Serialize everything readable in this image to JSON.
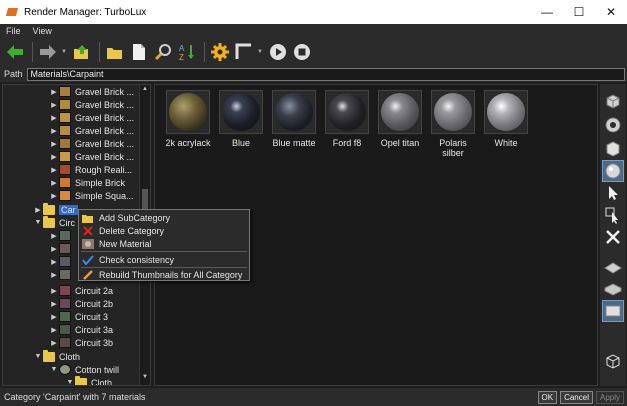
{
  "window": {
    "title": "Render Manager: TurboLux"
  },
  "menu": {
    "file": "File",
    "view": "View"
  },
  "path": {
    "label": "Path",
    "value": "Materials\\Carpaint"
  },
  "tree": {
    "items": [
      {
        "label": "Gravel Brick ..."
      },
      {
        "label": "Gravel Brick ..."
      },
      {
        "label": "Gravel Brick ..."
      },
      {
        "label": "Gravel Brick ..."
      },
      {
        "label": "Gravel Brick ..."
      },
      {
        "label": "Gravel Brick ..."
      },
      {
        "label": "Rough Reali..."
      },
      {
        "label": "Simple Brick"
      },
      {
        "label": "Simple Squa..."
      },
      {
        "label": "Car"
      },
      {
        "label": "Circ"
      },
      {
        "label": "Circuit 2a"
      },
      {
        "label": "Circuit 2b"
      },
      {
        "label": "Circuit 3"
      },
      {
        "label": "Circuit 3a"
      },
      {
        "label": "Circuit 3b"
      },
      {
        "label": "Cloth"
      },
      {
        "label": "Cotton twill"
      },
      {
        "label": "Cloth"
      }
    ]
  },
  "materials": [
    {
      "name": "2k acrylack"
    },
    {
      "name": "Blue"
    },
    {
      "name": "Blue matte"
    },
    {
      "name": "Ford f8"
    },
    {
      "name": "Opel titan"
    },
    {
      "name": "Polaris silber"
    },
    {
      "name": "White"
    }
  ],
  "context_menu": {
    "add_subcategory": "Add SubCategory",
    "delete_category": "Delete Category",
    "new_material": "New Material",
    "check_consistency": "Check consistency",
    "rebuild_thumbnails": "Rebuild Thumbnails for All Category"
  },
  "status": {
    "text": "Category 'Carpaint' with 7 materials",
    "ok": "OK",
    "cancel": "Cancel",
    "apply": "Apply"
  },
  "colors": {
    "selection": "#2d6bd0",
    "folder": "#e8c84a",
    "back_arrow": "#3fae2a"
  }
}
